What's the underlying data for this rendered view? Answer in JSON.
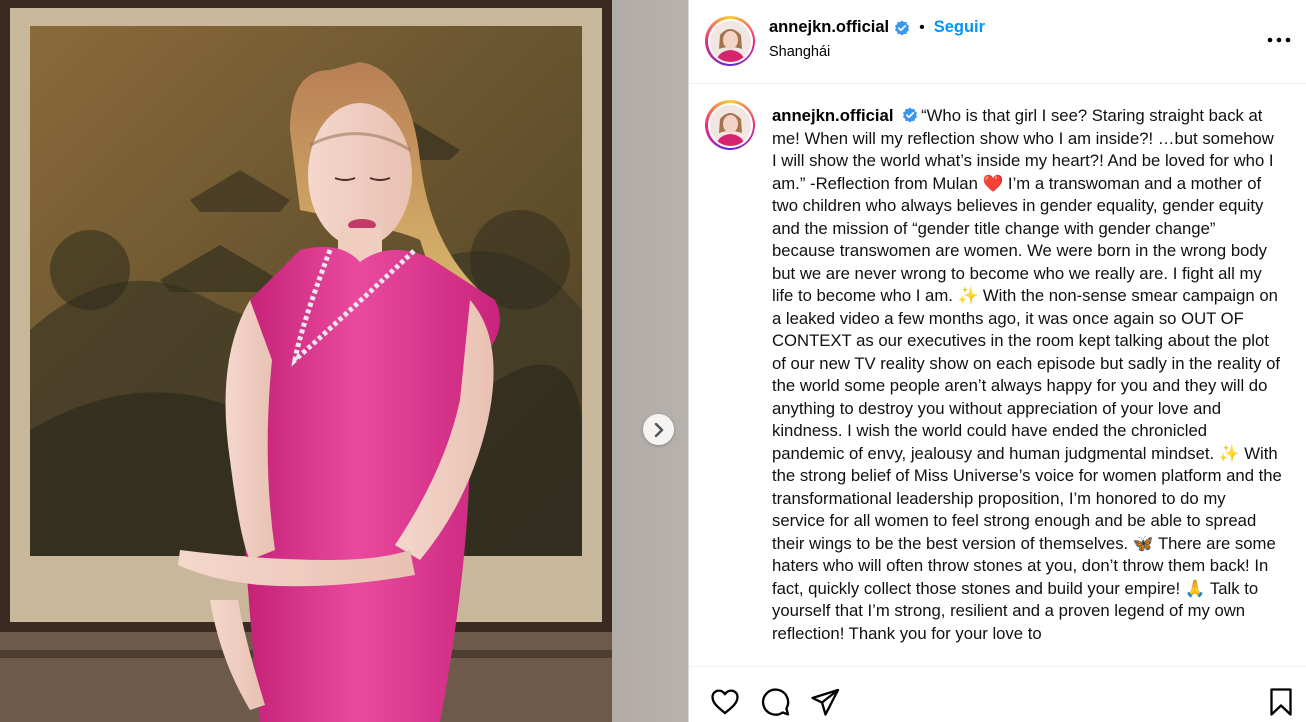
{
  "post": {
    "username": "annejkn.official",
    "separator": "•",
    "follow_label": "Seguir",
    "location": "Shanghái"
  },
  "caption": {
    "username": "annejkn.official",
    "part1": "“Who is that girl I see? Staring straight back at me! When will my reflection show who I am inside?! …but somehow I will show the world what’s inside my heart?! And be loved for who I am.” -Reflection from Mulan ",
    "emoji1": "❤️",
    "part2": " I’m a transwoman and a mother of two children who always believes in gender equality, gender equity and the mission of “gender title change with gender change” because transwomen are women. We were born in the wrong body but we are never wrong to become who we really are. I fight all my life to become who I am. ",
    "emoji2": "✨",
    "part3": " With the non-sense smear campaign on a leaked video a few months ago, it was once again so OUT OF CONTEXT as our executives in the room kept talking about the plot of our new TV reality show on each episode but sadly in the reality of the world some people aren’t always happy for you and they will do anything to destroy you without appreciation of your love and kindness. I wish the world could have ended the chronicled pandemic of envy, jealousy and human judgmental mindset. ",
    "emoji3": "✨",
    "part4": " With the strong belief of Miss Universe’s voice for women platform and the transformational leadership proposition, I’m honored to do my service for all women to feel strong enough and be able to spread their wings to be the best version of themselves. ",
    "emoji4": "🦋",
    "part5": " There are some haters who will often throw stones at you, don’t throw them back! In fact, quickly collect those stones and build your empire! ",
    "emoji5": "🙏",
    "part6": " Talk to yourself that I’m strong, resilient and a proven legend of my own reflection! Thank you for your love to"
  },
  "icons": {
    "verified": "verified-badge-icon",
    "more": "more-options-icon",
    "next": "chevron-right-icon",
    "like": "heart-icon",
    "comment": "comment-icon",
    "share": "paper-plane-icon",
    "save": "bookmark-icon"
  },
  "colors": {
    "accent": "#0095f6",
    "verified": "#3897f0",
    "dress": "#e83e95"
  }
}
